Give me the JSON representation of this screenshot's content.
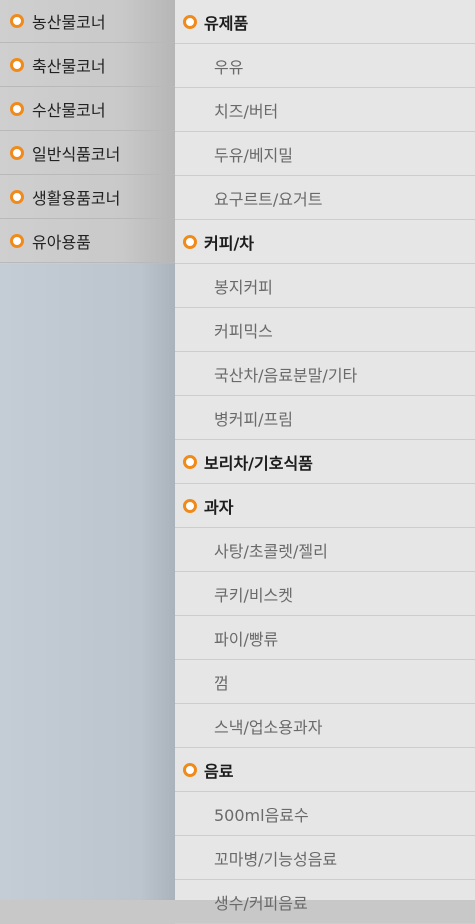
{
  "left_categories": [
    {
      "label": "농산물코너"
    },
    {
      "label": "축산물코너"
    },
    {
      "label": "수산물코너"
    },
    {
      "label": "일반식품코너"
    },
    {
      "label": "생활용품코너"
    },
    {
      "label": "유아용품"
    }
  ],
  "right_items": [
    {
      "label": "유제품",
      "kind": "header"
    },
    {
      "label": "우유",
      "kind": "sub"
    },
    {
      "label": "치즈/버터",
      "kind": "sub"
    },
    {
      "label": "두유/베지밀",
      "kind": "sub"
    },
    {
      "label": "요구르트/요거트",
      "kind": "sub"
    },
    {
      "label": "커피/차",
      "kind": "header"
    },
    {
      "label": "봉지커피",
      "kind": "sub"
    },
    {
      "label": "커피믹스",
      "kind": "sub"
    },
    {
      "label": "국산차/음료분말/기타",
      "kind": "sub"
    },
    {
      "label": "병커피/프림",
      "kind": "sub"
    },
    {
      "label": "보리차/기호식품",
      "kind": "header"
    },
    {
      "label": "과자",
      "kind": "header"
    },
    {
      "label": "사탕/초콜렛/젤리",
      "kind": "sub"
    },
    {
      "label": "쿠키/비스켓",
      "kind": "sub"
    },
    {
      "label": "파이/빵류",
      "kind": "sub"
    },
    {
      "label": "껌",
      "kind": "sub"
    },
    {
      "label": "스낵/업소용과자",
      "kind": "sub"
    },
    {
      "label": "음료",
      "kind": "header"
    },
    {
      "label": "500ml음료수",
      "kind": "sub"
    },
    {
      "label": "꼬마병/기능성음료",
      "kind": "sub"
    },
    {
      "label": "생수/커피음료",
      "kind": "sub"
    }
  ],
  "icons": {
    "bullet": "orange-ring-bullet-icon"
  },
  "colors": {
    "accent": "#f08a1a"
  }
}
